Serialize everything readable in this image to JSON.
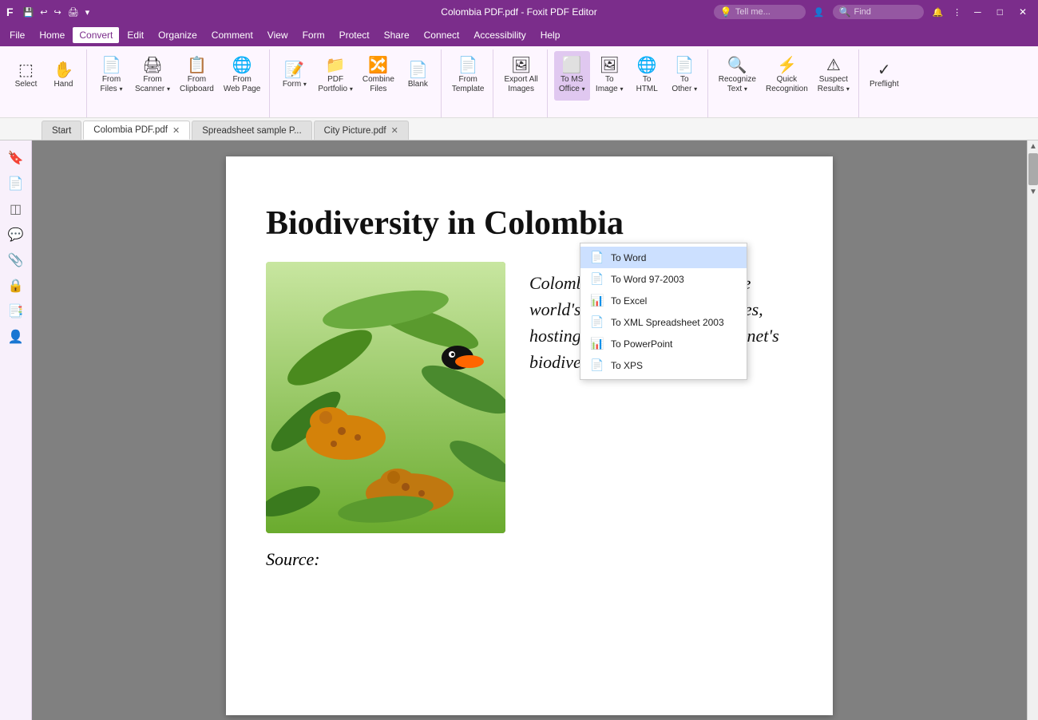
{
  "titleBar": {
    "title": "Colombia PDF.pdf - Foxit PDF Editor",
    "appName": "Foxit PDF Editor",
    "minimize": "─",
    "maximize": "□",
    "close": "✕"
  },
  "menuBar": {
    "items": [
      "File",
      "Home",
      "Convert",
      "Edit",
      "Organize",
      "Comment",
      "View",
      "Form",
      "Protect",
      "Share",
      "Connect",
      "Accessibility",
      "Help"
    ]
  },
  "ribbon": {
    "activeMenu": "Convert",
    "groups": [
      {
        "items": [
          {
            "icon": "☰",
            "label": "Select"
          },
          {
            "icon": "✋",
            "label": "Hand"
          }
        ]
      },
      {
        "items": [
          {
            "icon": "📄",
            "label": "From Files",
            "dropdown": true
          },
          {
            "icon": "🖨",
            "label": "From Scanner",
            "dropdown": true
          },
          {
            "icon": "📋",
            "label": "From Clipboard"
          },
          {
            "icon": "🌐",
            "label": "From Web Page"
          }
        ]
      },
      {
        "items": [
          {
            "icon": "📝",
            "label": "Form",
            "dropdown": true
          },
          {
            "icon": "📁",
            "label": "PDF Portfolio",
            "dropdown": true
          },
          {
            "icon": "🔀",
            "label": "Combine Files"
          },
          {
            "icon": "📄",
            "label": "Blank"
          }
        ]
      },
      {
        "items": [
          {
            "icon": "📄",
            "label": "From Template"
          }
        ]
      },
      {
        "items": [
          {
            "icon": "🖼",
            "label": "Export All Images"
          }
        ]
      },
      {
        "items": [
          {
            "icon": "⬜",
            "label": "To MS Office",
            "dropdown": true,
            "active": true
          },
          {
            "icon": "🖼",
            "label": "To Image",
            "dropdown": true
          },
          {
            "icon": "🌐",
            "label": "To HTML"
          },
          {
            "icon": "📄",
            "label": "To Other",
            "dropdown": true
          }
        ]
      },
      {
        "items": [
          {
            "icon": "🔍",
            "label": "Recognize Text",
            "dropdown": true
          },
          {
            "icon": "⚡",
            "label": "Quick Recognition"
          },
          {
            "icon": "⚠",
            "label": "Suspect Results",
            "dropdown": true
          }
        ]
      },
      {
        "items": [
          {
            "icon": "✓",
            "label": "Preflight"
          }
        ]
      }
    ]
  },
  "tabs": [
    {
      "label": "Start",
      "active": false,
      "closable": false
    },
    {
      "label": "Colombia PDF.pdf",
      "active": true,
      "closable": true
    },
    {
      "label": "Spreadsheet sample P...",
      "active": false,
      "closable": false
    },
    {
      "label": "City Picture.pdf",
      "active": false,
      "closable": true
    }
  ],
  "sidebarIcons": [
    "🔖",
    "📄",
    "👁",
    "💬",
    "📎",
    "🔒",
    "📑",
    "👤"
  ],
  "document": {
    "title": "Biodiversity in Colombia",
    "quote": "Colombia is listed as one of the world's \"megadiverse\" countries, hosting close to 10% of the planet's biodiversity.",
    "source": "Source:"
  },
  "dropdown": {
    "items": [
      {
        "label": "To Word",
        "highlighted": true
      },
      {
        "label": "To Word 97-2003"
      },
      {
        "label": "To Excel"
      },
      {
        "label": "To XML Spreadsheet 2003"
      },
      {
        "label": "To PowerPoint"
      },
      {
        "label": "To XPS"
      }
    ]
  },
  "searchBar": {
    "placeholder": "Tell me...",
    "searchPlaceholder": "Find"
  }
}
